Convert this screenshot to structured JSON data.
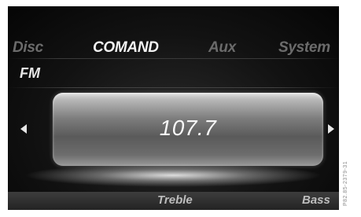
{
  "tabs": [
    {
      "label": "Disc",
      "active": false
    },
    {
      "label": "COMAND",
      "active": true
    },
    {
      "label": "Aux",
      "active": false
    },
    {
      "label": "System",
      "active": false
    }
  ],
  "band": "FM",
  "frequency": "107.7",
  "navigation": {
    "left_icon": "arrow-left-icon",
    "right_icon": "arrow-right-icon"
  },
  "bottom_bar": {
    "treble_label": "Treble",
    "bass_label": "Bass"
  },
  "image_code": "P82.85-2379-31"
}
